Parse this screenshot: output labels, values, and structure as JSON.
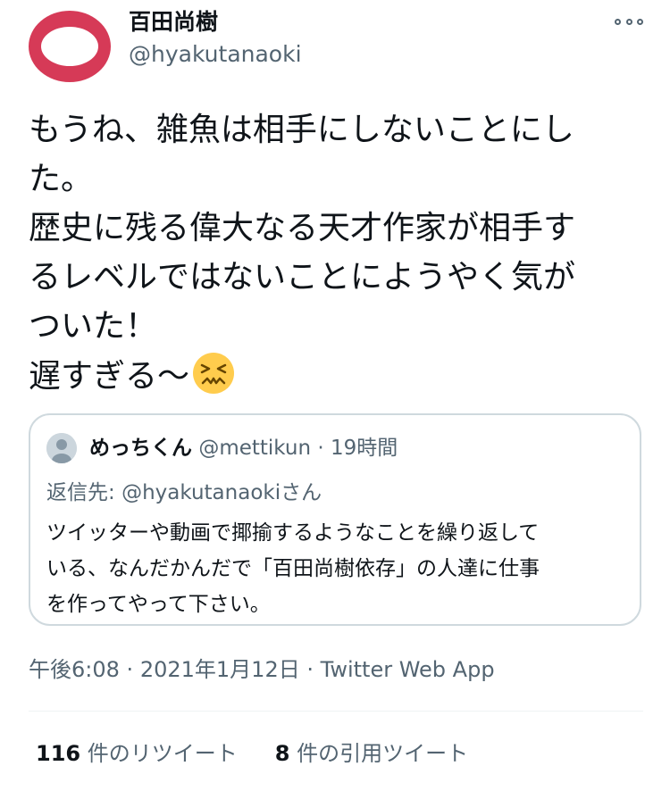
{
  "author": {
    "name": "百田尚樹",
    "handle": "@hyakutanaoki",
    "avatar_color": "#d63a57"
  },
  "tweet": {
    "lines": [
      "もうね、雑魚は相手にしないことにし",
      "た。",
      "歴史に残る偉大なる天才作家が相手す",
      "るレベルではないことにようやく気が",
      "ついた！",
      "遅すぎる〜"
    ],
    "emoji_icon": "confounded-face-icon"
  },
  "quote": {
    "name": "めっちくん",
    "handle": "@mettikun",
    "separator": "·",
    "time": "19時間",
    "reply_prefix": "返信先: ",
    "reply_handle": "@hyakutanaoki",
    "reply_suffix": "さん",
    "lines": [
      "ツイッターや動画で揶揄するようなことを繰り返して",
      "いる、なんだかんだで「百田尚樹依存」の人達に仕事",
      "を作ってやって下さい。"
    ]
  },
  "meta": {
    "time": "午後6:08",
    "date": "2021年1月12日",
    "separator": "·",
    "source": "Twitter Web App"
  },
  "stats": {
    "retweets_count": "116",
    "retweets_label": "件のリツイート",
    "quotes_count": "8",
    "quotes_label": "件の引用ツイート"
  },
  "colors": {
    "text": "#0f1419",
    "secondary": "#536471",
    "border": "#cfd9de"
  }
}
